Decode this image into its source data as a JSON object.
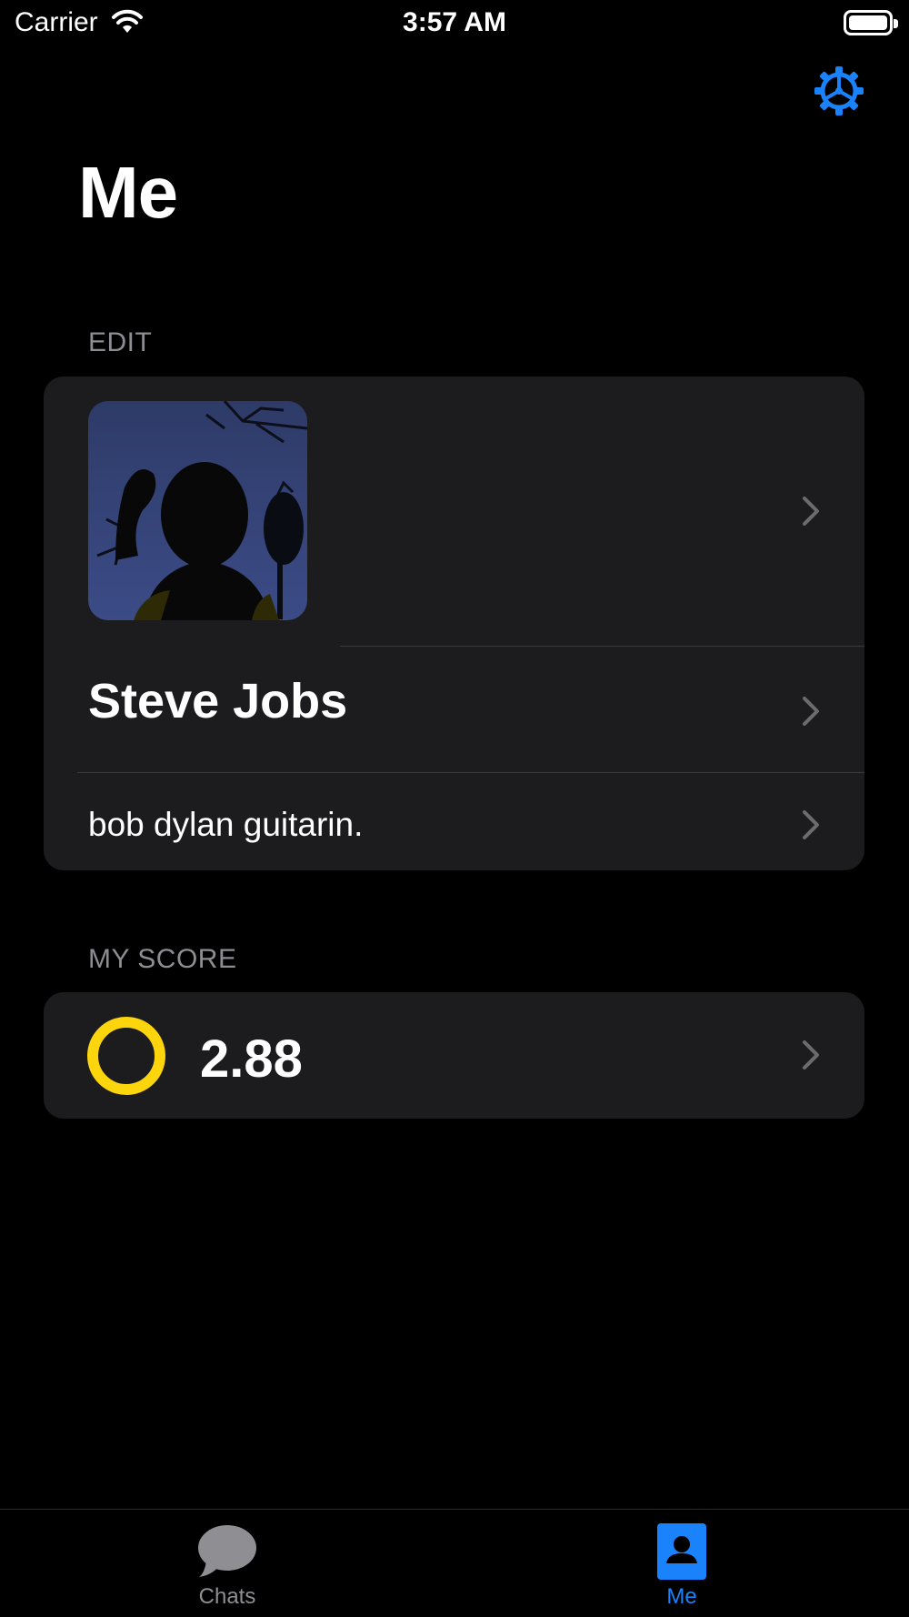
{
  "status_bar": {
    "carrier": "Carrier",
    "time": "3:57 AM",
    "icons": [
      "wifi-icon",
      "battery-icon"
    ]
  },
  "nav": {
    "title": "Me",
    "settings_icon": "gear-icon",
    "accent_color": "#1a82fb"
  },
  "sections": {
    "edit": {
      "header": "EDIT",
      "avatar_description": "profile-photo",
      "name": "Steve Jobs",
      "bio": "bob dylan guitarin."
    },
    "score": {
      "header": "MY SCORE",
      "value": "2.88",
      "ring_color": "#fdd50c",
      "ring_icon": "score-ring-icon"
    }
  },
  "tab_bar": {
    "tabs": [
      {
        "label": "Chats",
        "icon": "chat-bubble-icon",
        "active": false
      },
      {
        "label": "Me",
        "icon": "person-icon",
        "active": true
      }
    ],
    "active_color": "#1a82fb",
    "inactive_color": "#8e8e93"
  }
}
